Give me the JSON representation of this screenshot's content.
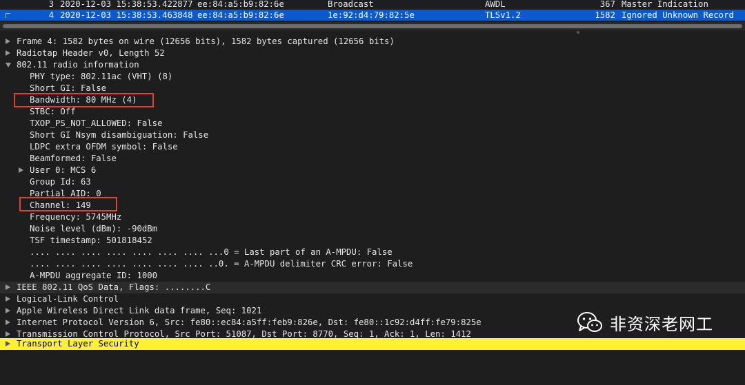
{
  "packet_list": {
    "rows": [
      {
        "no": "3",
        "time": "2020-12-03 15:38:53.422877",
        "src": "ee:84:a5:b9:82:6e",
        "dst": "Broadcast",
        "proto": "AWDL",
        "len": "367",
        "info": "Master Indication"
      },
      {
        "no": "4",
        "time": "2020-12-03 15:38:53.463848",
        "src": "ee:84:a5:b9:82:6e",
        "dst": "1e:92:d4:79:82:5e",
        "proto": "TLSv1.2",
        "len": "1582",
        "info": "Ignored Unknown Record"
      }
    ]
  },
  "details": {
    "frame": "Frame 4: 1582 bytes on wire (12656 bits), 1582 bytes captured (12656 bits)",
    "radiotap": "Radiotap Header v0, Length 52",
    "radio_info": "802.11 radio information",
    "radio_fields": {
      "phy": "PHY type: 802.11ac (VHT) (8)",
      "short_gi": "Short GI: False",
      "bandwidth": "Bandwidth: 80 MHz (4)",
      "stbc": "STBC: Off",
      "txop": "TXOP_PS_NOT_ALLOWED: False",
      "short_gi_nsym": "Short GI Nsym disambiguation: False",
      "ldpc": "LDPC extra OFDM symbol: False",
      "beamformed": "Beamformed: False",
      "user0": "User 0: MCS 6",
      "group_id": "Group Id: 63",
      "partial_aid": "Partial AID: 0",
      "channel": "Channel: 149",
      "frequency": "Frequency: 5745MHz",
      "noise": "Noise level (dBm): -90dBm",
      "tsf": "TSF timestamp: 501818452",
      "last_part": ".... .... .... .... .... .... .... ...0 = Last part of an A-MPDU: False",
      "crc_error": ".... .... .... .... .... .... .... ..0. = A-MPDU delimiter CRC error: False",
      "ampdu_id": "A-MPDU aggregate ID: 1000"
    },
    "ieee": "IEEE 802.11 QoS Data, Flags: ........C",
    "llc": "Logical-Link Control",
    "awdl": "Apple Wireless Direct Link data frame, Seq: 1021",
    "ipv6": "Internet Protocol Version 6, Src: fe80::ec84:a5ff:feb9:826e, Dst: fe80::1c92:d4ff:fe79:825e",
    "tcp": "Transmission Control Protocol, Src Port: 51087, Dst Port: 8770, Seq: 1, Ack: 1, Len: 1412",
    "tls": "Transport Layer Security"
  },
  "watermark": {
    "text": "非资深老网工",
    "icon": "wechat-icon"
  },
  "colors": {
    "selected_row": "#0b59cc",
    "highlight": "#fff034",
    "annotation_box": "#e0432f"
  }
}
